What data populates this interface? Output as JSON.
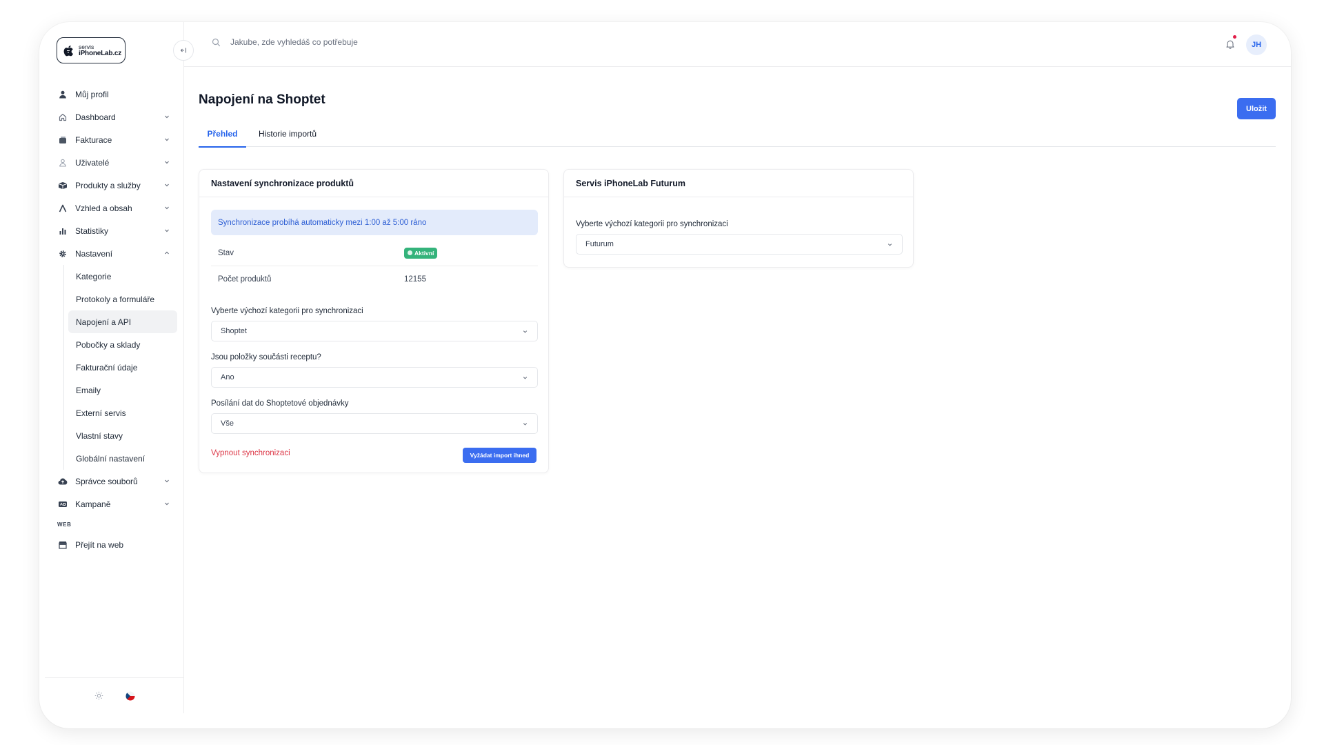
{
  "brand": {
    "line1": "servis",
    "line2": "iPhoneLab.cz"
  },
  "search": {
    "placeholder": "Jakube, zde vyhledáš co potřebuje"
  },
  "user": {
    "initials": "JH"
  },
  "sidebar": {
    "items": [
      {
        "label": "Můj profil",
        "icon": "user-icon"
      },
      {
        "label": "Dashboard",
        "icon": "home-icon"
      },
      {
        "label": "Fakturace",
        "icon": "invoice-icon"
      },
      {
        "label": "Uživatelé",
        "icon": "users-icon"
      },
      {
        "label": "Produkty a služby",
        "icon": "box-icon"
      },
      {
        "label": "Vzhled a obsah",
        "icon": "design-icon"
      },
      {
        "label": "Statistiky",
        "icon": "bar-chart-icon"
      },
      {
        "label": "Nastavení",
        "icon": "gear-icon"
      }
    ],
    "settings_sub": [
      {
        "label": "Kategorie"
      },
      {
        "label": "Protokoly a formuláře"
      },
      {
        "label": "Napojení a API"
      },
      {
        "label": "Pobočky a sklady"
      },
      {
        "label": "Fakturační údaje"
      },
      {
        "label": "Emaily"
      },
      {
        "label": "Externí servis"
      },
      {
        "label": "Vlastní stavy"
      },
      {
        "label": "Globální nastavení"
      }
    ],
    "after_items": [
      {
        "label": "Správce souborů",
        "icon": "cloud-icon"
      },
      {
        "label": "Kampaně",
        "icon": "campaign-icon"
      }
    ],
    "web_section": {
      "label": "WEB",
      "items": [
        {
          "label": "Přejít na web",
          "icon": "store-icon"
        }
      ]
    },
    "active_sub": "Napojení a API"
  },
  "page": {
    "title": "Napojení na Shoptet",
    "save_label": "Uložit"
  },
  "tabs": [
    {
      "label": "Přehled",
      "active": true
    },
    {
      "label": "Historie importů",
      "active": false
    }
  ],
  "sync_card": {
    "title": "Nastavení synchronizace produktů",
    "info": "Synchronizace probíhá automaticky mezi 1:00 až 5:00 ráno",
    "status_label": "Stav",
    "status_value": "Aktivní",
    "count_label": "Počet produktů",
    "count_value": "12155",
    "category_label": "Vyberte výchozí kategorii pro synchronizaci",
    "category_value": "Shoptet",
    "recipe_label": "Jsou položky součásti receptu?",
    "recipe_value": "Ano",
    "orders_label": "Posílání dat do Shoptetové objednávky",
    "orders_value": "Vše",
    "disable_label": "Vypnout synchronizaci",
    "import_label": "Vyžádat import ihned"
  },
  "futurum_card": {
    "title": "Servis iPhoneLab Futurum",
    "category_label": "Vyberte výchozí kategorii pro synchronizaci",
    "category_value": "Futurum"
  },
  "colors": {
    "accent": "#3b6df0",
    "success": "#34b37b",
    "danger": "#dc3545",
    "info_bg": "#e3ebfb"
  }
}
